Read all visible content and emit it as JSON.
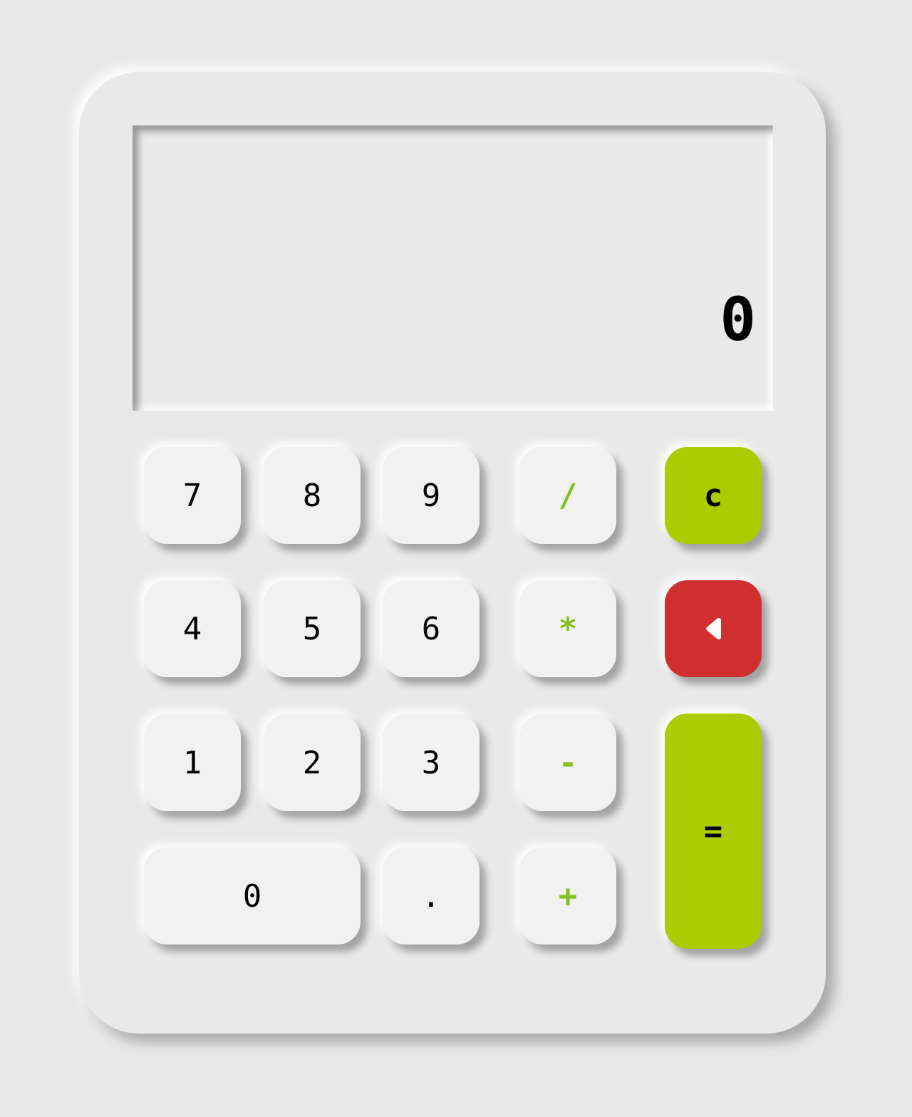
{
  "display": {
    "value": "0"
  },
  "keys": {
    "seven": "7",
    "eight": "8",
    "nine": "9",
    "divide": "/",
    "clear": "c",
    "four": "4",
    "five": "5",
    "six": "6",
    "multiply": "*",
    "one": "1",
    "two": "2",
    "three": "3",
    "subtract": "-",
    "equals": "=",
    "zero": "0",
    "decimal": ".",
    "add": "+"
  },
  "icons": {
    "backspace": "backspace-icon"
  },
  "colors": {
    "background": "#e8e8e8",
    "accent_green": "#aacc00",
    "operator_green": "#85c020",
    "backspace_red": "#d12f2f"
  }
}
